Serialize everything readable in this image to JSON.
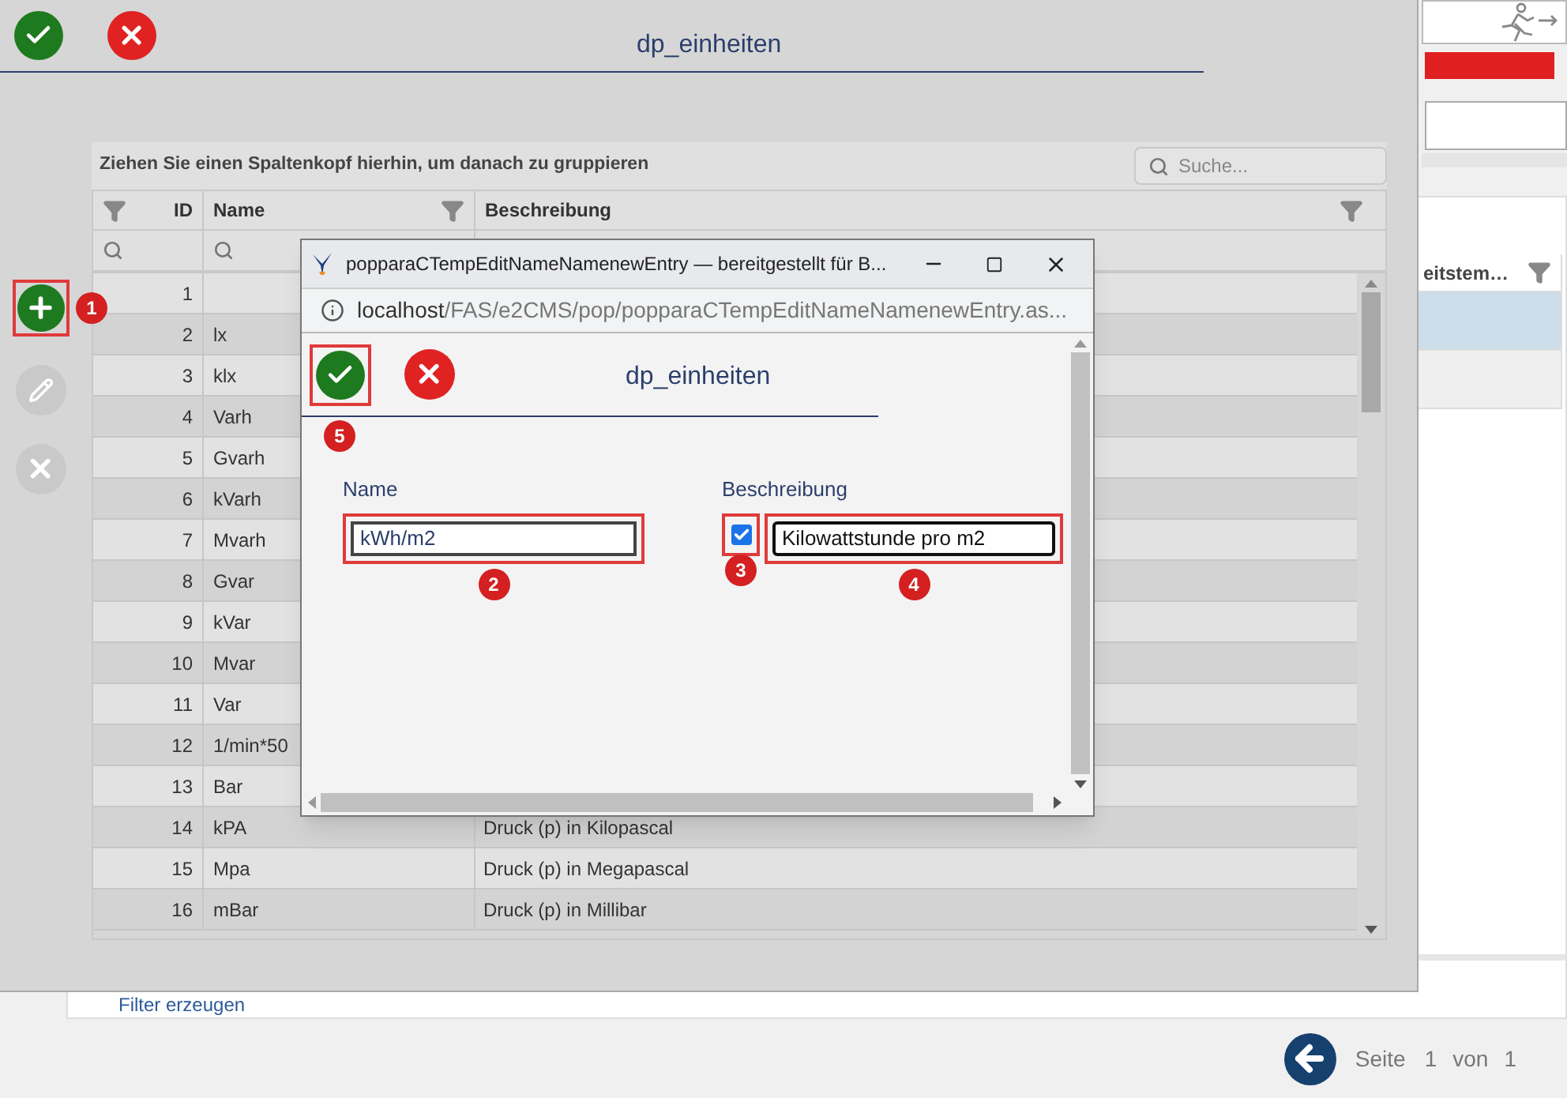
{
  "background": {
    "column_header": "eitstem…",
    "rows": [
      {
        "selected": true
      },
      {
        "selected": false
      }
    ],
    "filter_link": "Filter erzeugen",
    "pager": {
      "label": "Seite",
      "page": "1",
      "of": "von",
      "total": "1"
    }
  },
  "dialog": {
    "title": "dp_einheiten",
    "toolbar": [
      {
        "kind": "add",
        "disabled": false,
        "callout": "1"
      },
      {
        "kind": "edit",
        "disabled": true
      },
      {
        "kind": "delete",
        "disabled": true
      }
    ],
    "group_hint": "Ziehen Sie einen Spaltenkopf hierhin, um danach zu gruppieren",
    "search": {
      "placeholder": "Suche..."
    },
    "columns": [
      {
        "label": "ID"
      },
      {
        "label": "Name"
      },
      {
        "label": "Beschreibung"
      }
    ],
    "rows": [
      {
        "number": "1"
      },
      {
        "number": "2",
        "name": "lx"
      },
      {
        "number": "3",
        "name": "klx"
      },
      {
        "number": "4",
        "name": "Varh"
      },
      {
        "number": "5",
        "name": "Gvarh"
      },
      {
        "number": "6",
        "name": "kVarh"
      },
      {
        "number": "7",
        "name": "Mvarh"
      },
      {
        "number": "8",
        "name": "Gvar"
      },
      {
        "number": "9",
        "name": "kVar"
      },
      {
        "number": "10",
        "name": "Mvar"
      },
      {
        "number": "11",
        "name": "Var"
      },
      {
        "number": "12",
        "name": "1/min*50"
      },
      {
        "number": "13",
        "name": "Bar"
      },
      {
        "number": "14",
        "name": "kPA",
        "description": "Druck (p) in Kilopascal"
      },
      {
        "number": "15",
        "name": "Mpa",
        "description": "Druck (p) in Megapascal"
      },
      {
        "number": "16",
        "name": "mBar",
        "description": "Druck (p) in Millibar"
      }
    ]
  },
  "popup": {
    "title": "popparaCTempEditNameNamenewEntry — bereitgestellt für B...",
    "url_host": "localhost",
    "url_path": "/FAS/e2CMS/pop/popparaCTempEditNameNamenewEntry.as...",
    "heading": "dp_einheiten",
    "save_callout": "5",
    "fields": [
      {
        "kind": "text",
        "label": "Name",
        "value": "kWh/m2",
        "callout": "2"
      },
      {
        "kind": "checked_text",
        "label": "Beschreibung",
        "checked": true,
        "checkbox_callout": "3",
        "value": "Kilowattstunde pro m2",
        "callout": "4"
      }
    ]
  }
}
